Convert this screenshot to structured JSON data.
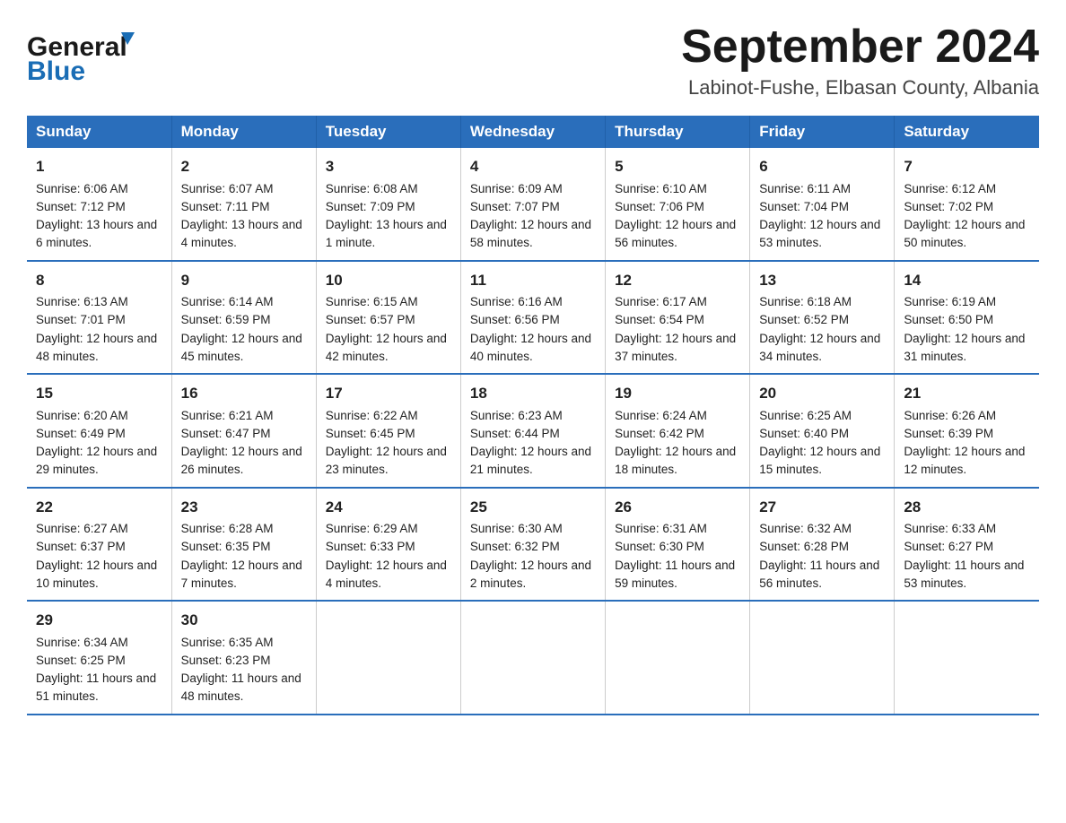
{
  "logo": {
    "line1": "General",
    "line2": "Blue"
  },
  "title": "September 2024",
  "subtitle": "Labinot-Fushe, Elbasan County, Albania",
  "headers": [
    "Sunday",
    "Monday",
    "Tuesday",
    "Wednesday",
    "Thursday",
    "Friday",
    "Saturday"
  ],
  "weeks": [
    [
      {
        "day": "1",
        "sunrise": "6:06 AM",
        "sunset": "7:12 PM",
        "daylight": "13 hours and 6 minutes."
      },
      {
        "day": "2",
        "sunrise": "6:07 AM",
        "sunset": "7:11 PM",
        "daylight": "13 hours and 4 minutes."
      },
      {
        "day": "3",
        "sunrise": "6:08 AM",
        "sunset": "7:09 PM",
        "daylight": "13 hours and 1 minute."
      },
      {
        "day": "4",
        "sunrise": "6:09 AM",
        "sunset": "7:07 PM",
        "daylight": "12 hours and 58 minutes."
      },
      {
        "day": "5",
        "sunrise": "6:10 AM",
        "sunset": "7:06 PM",
        "daylight": "12 hours and 56 minutes."
      },
      {
        "day": "6",
        "sunrise": "6:11 AM",
        "sunset": "7:04 PM",
        "daylight": "12 hours and 53 minutes."
      },
      {
        "day": "7",
        "sunrise": "6:12 AM",
        "sunset": "7:02 PM",
        "daylight": "12 hours and 50 minutes."
      }
    ],
    [
      {
        "day": "8",
        "sunrise": "6:13 AM",
        "sunset": "7:01 PM",
        "daylight": "12 hours and 48 minutes."
      },
      {
        "day": "9",
        "sunrise": "6:14 AM",
        "sunset": "6:59 PM",
        "daylight": "12 hours and 45 minutes."
      },
      {
        "day": "10",
        "sunrise": "6:15 AM",
        "sunset": "6:57 PM",
        "daylight": "12 hours and 42 minutes."
      },
      {
        "day": "11",
        "sunrise": "6:16 AM",
        "sunset": "6:56 PM",
        "daylight": "12 hours and 40 minutes."
      },
      {
        "day": "12",
        "sunrise": "6:17 AM",
        "sunset": "6:54 PM",
        "daylight": "12 hours and 37 minutes."
      },
      {
        "day": "13",
        "sunrise": "6:18 AM",
        "sunset": "6:52 PM",
        "daylight": "12 hours and 34 minutes."
      },
      {
        "day": "14",
        "sunrise": "6:19 AM",
        "sunset": "6:50 PM",
        "daylight": "12 hours and 31 minutes."
      }
    ],
    [
      {
        "day": "15",
        "sunrise": "6:20 AM",
        "sunset": "6:49 PM",
        "daylight": "12 hours and 29 minutes."
      },
      {
        "day": "16",
        "sunrise": "6:21 AM",
        "sunset": "6:47 PM",
        "daylight": "12 hours and 26 minutes."
      },
      {
        "day": "17",
        "sunrise": "6:22 AM",
        "sunset": "6:45 PM",
        "daylight": "12 hours and 23 minutes."
      },
      {
        "day": "18",
        "sunrise": "6:23 AM",
        "sunset": "6:44 PM",
        "daylight": "12 hours and 21 minutes."
      },
      {
        "day": "19",
        "sunrise": "6:24 AM",
        "sunset": "6:42 PM",
        "daylight": "12 hours and 18 minutes."
      },
      {
        "day": "20",
        "sunrise": "6:25 AM",
        "sunset": "6:40 PM",
        "daylight": "12 hours and 15 minutes."
      },
      {
        "day": "21",
        "sunrise": "6:26 AM",
        "sunset": "6:39 PM",
        "daylight": "12 hours and 12 minutes."
      }
    ],
    [
      {
        "day": "22",
        "sunrise": "6:27 AM",
        "sunset": "6:37 PM",
        "daylight": "12 hours and 10 minutes."
      },
      {
        "day": "23",
        "sunrise": "6:28 AM",
        "sunset": "6:35 PM",
        "daylight": "12 hours and 7 minutes."
      },
      {
        "day": "24",
        "sunrise": "6:29 AM",
        "sunset": "6:33 PM",
        "daylight": "12 hours and 4 minutes."
      },
      {
        "day": "25",
        "sunrise": "6:30 AM",
        "sunset": "6:32 PM",
        "daylight": "12 hours and 2 minutes."
      },
      {
        "day": "26",
        "sunrise": "6:31 AM",
        "sunset": "6:30 PM",
        "daylight": "11 hours and 59 minutes."
      },
      {
        "day": "27",
        "sunrise": "6:32 AM",
        "sunset": "6:28 PM",
        "daylight": "11 hours and 56 minutes."
      },
      {
        "day": "28",
        "sunrise": "6:33 AM",
        "sunset": "6:27 PM",
        "daylight": "11 hours and 53 minutes."
      }
    ],
    [
      {
        "day": "29",
        "sunrise": "6:34 AM",
        "sunset": "6:25 PM",
        "daylight": "11 hours and 51 minutes."
      },
      {
        "day": "30",
        "sunrise": "6:35 AM",
        "sunset": "6:23 PM",
        "daylight": "11 hours and 48 minutes."
      },
      null,
      null,
      null,
      null,
      null
    ]
  ]
}
